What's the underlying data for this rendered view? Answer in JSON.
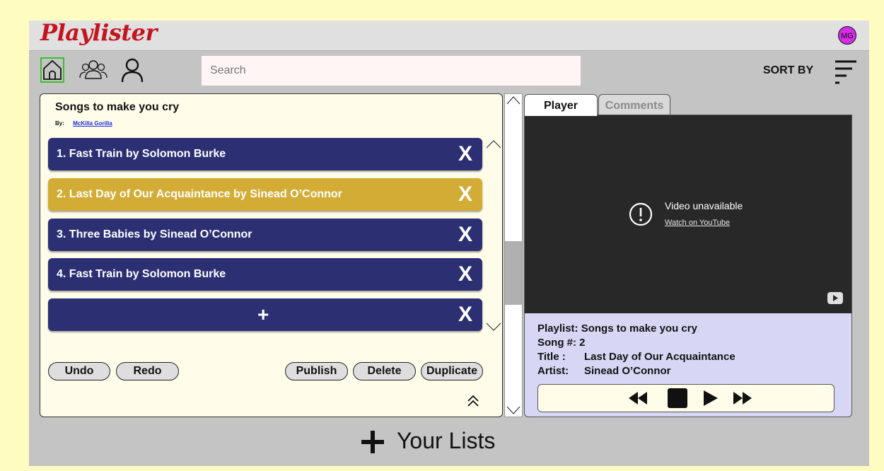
{
  "app": {
    "logo": "Playlister",
    "avatar_initials": "MG"
  },
  "nav": {
    "home_icon": "home-icon",
    "groups_icon": "users-icon",
    "user_icon": "user-icon",
    "search_placeholder": "Search",
    "sort_label": "SORT BY",
    "sort_icon": "sort-icon"
  },
  "playlist": {
    "title": "Songs to make you cry",
    "by_label": "By:",
    "author": "McKilla Gorilla",
    "songs": [
      {
        "label": "1. Fast Train by Solomon Burke",
        "remove": "X"
      },
      {
        "label": "2. Last Day of Our Acquaintance by Sinead O’Connor",
        "remove": "X"
      },
      {
        "label": "3. Three Babies by Sinead O’Connor",
        "remove": "X"
      },
      {
        "label": "4. Fast Train by Solomon Burke",
        "remove": "X"
      }
    ],
    "add_song": {
      "label": "+",
      "remove": "X"
    },
    "active_index": 1
  },
  "actions": {
    "undo": "Undo",
    "redo": "Redo",
    "publish": "Publish",
    "delete": "Delete",
    "duplicate": "Duplicate"
  },
  "tabs": {
    "player": "Player",
    "comments": "Comments"
  },
  "video": {
    "message": "Video unavailable",
    "link": "Watch on YouTube"
  },
  "now_playing": {
    "playlist_label": "Playlist:",
    "playlist_value": "Songs to make you cry",
    "song_label": "Song #:",
    "song_value": "2",
    "title_label": "Title :",
    "title_value": "Last Day of Our Acquaintance",
    "artist_label": "Artist:",
    "artist_value": "Sinead O’Connor"
  },
  "footer": {
    "add_list_label": "Your Lists"
  },
  "colors": {
    "background": "#fffcc2",
    "song_card": "#2c3073",
    "song_active": "#d3ac36",
    "logo": "#c4141f",
    "avatar": "#d42de8",
    "player_info": "#d7d7f5"
  }
}
